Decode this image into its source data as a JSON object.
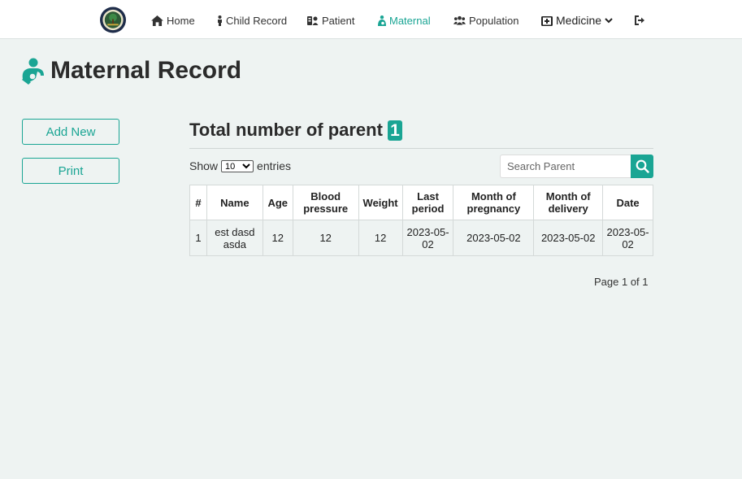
{
  "nav": {
    "items": [
      {
        "label": "Home",
        "icon": "home-icon"
      },
      {
        "label": "Child Record",
        "icon": "child-icon"
      },
      {
        "label": "Patient",
        "icon": "patient-icon"
      },
      {
        "label": "Maternal",
        "icon": "maternal-icon",
        "active": true
      },
      {
        "label": "Population",
        "icon": "users-icon"
      },
      {
        "label": "Medicine",
        "icon": "medkit-icon"
      }
    ],
    "logout_icon": "sign-out-icon"
  },
  "page": {
    "title": "Maternal Record",
    "title_icon": "maternal-icon"
  },
  "sidebar": {
    "add_label": "Add New",
    "print_label": "Print"
  },
  "summary": {
    "label": "Total number of parent",
    "count": "1"
  },
  "controls": {
    "show_label": "Show",
    "entries_value": "10",
    "entries_label": "entries",
    "search_placeholder": "Search Parent"
  },
  "table": {
    "headers": [
      "#",
      "Name",
      "Age",
      "Blood pressure",
      "Weight",
      "Last period",
      "Month of pregnancy",
      "Month of delivery",
      "Date"
    ],
    "rows": [
      [
        "1",
        "est dasd asda",
        "12",
        "12",
        "12",
        "2023-05-02",
        "2023-05-02",
        "2023-05-02",
        "2023-05-02"
      ]
    ]
  },
  "pager": {
    "text": "Page 1 of 1"
  },
  "colors": {
    "accent": "#1aa594",
    "background": "#eef3f2"
  }
}
